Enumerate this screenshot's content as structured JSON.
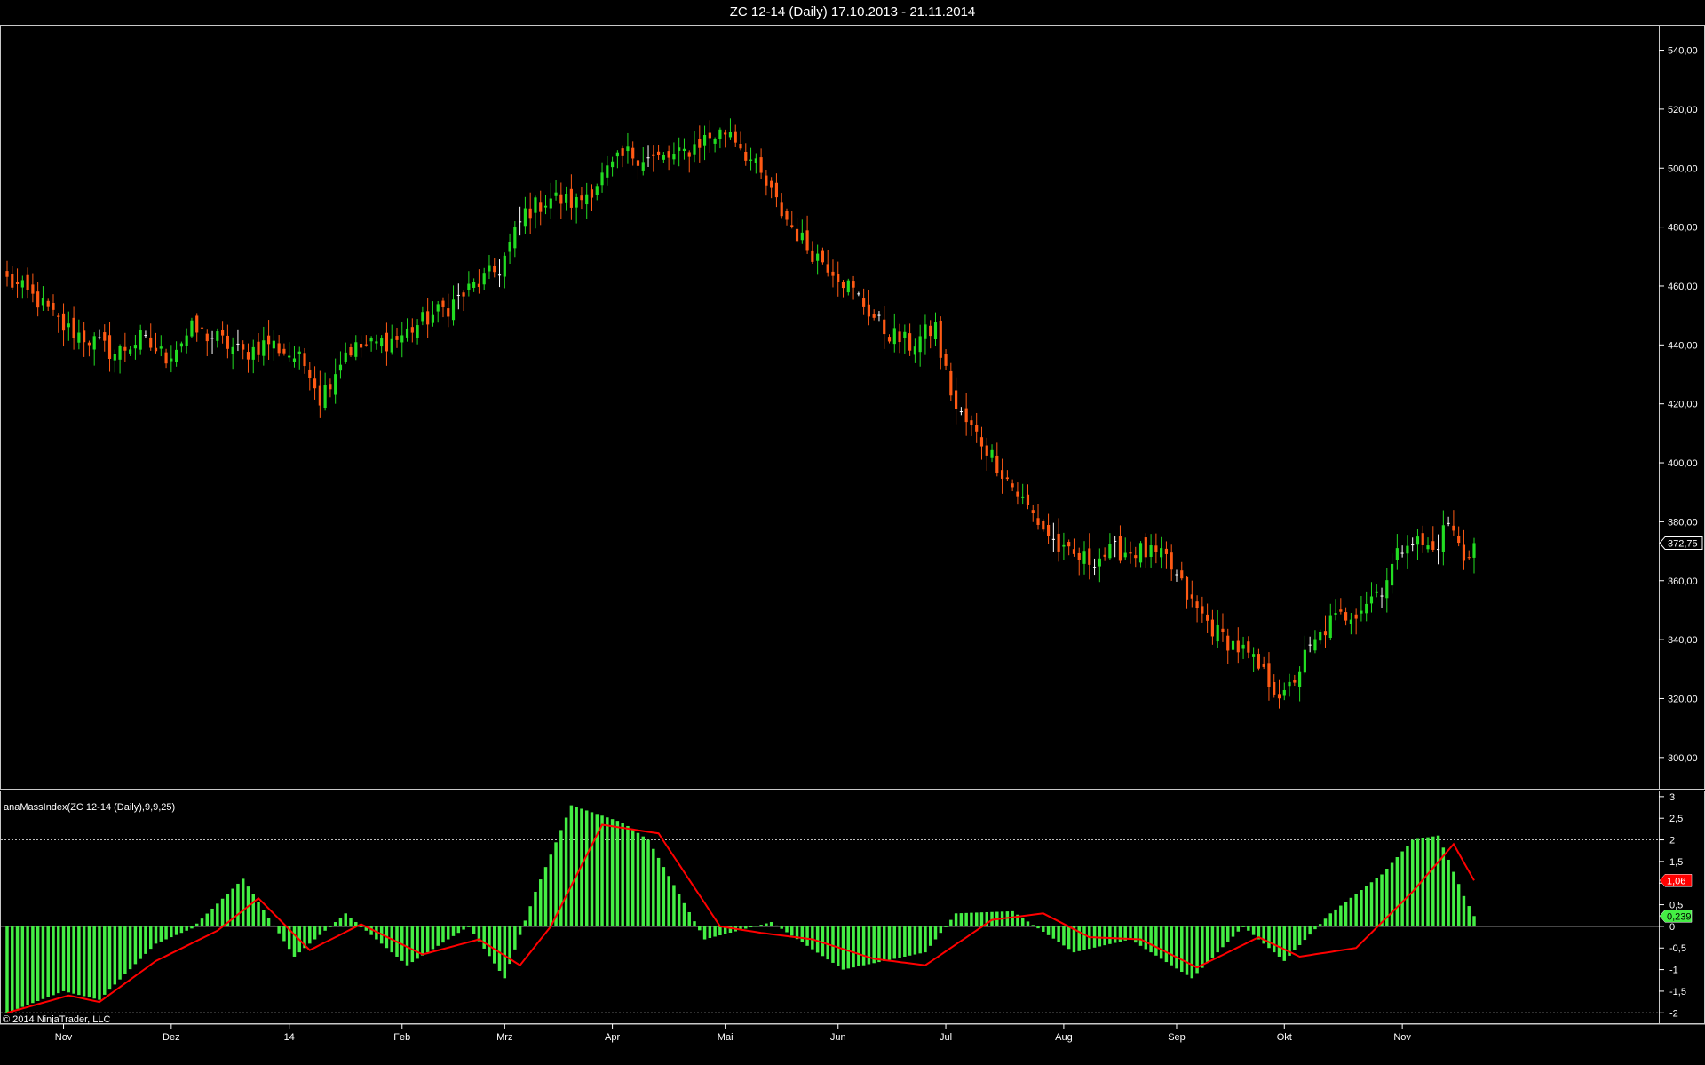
{
  "window": {
    "title": "ZC 12-14 (Daily)  17.10.2013 - 21.11.2014"
  },
  "colors": {
    "up": "#22dd22",
    "down": "#ff5a14",
    "doji": "#ffffff",
    "histogram": "#44ee44",
    "signal": "#ff0000",
    "axis": "#ffffff"
  },
  "chart_data": [
    {
      "type": "candlestick",
      "title": "ZC 12-14 (Daily)  17.10.2013 - 21.11.2014",
      "ylim": [
        290,
        548
      ],
      "y_ticks": [
        "300,00",
        "320,00",
        "340,00",
        "360,00",
        "380,00",
        "400,00",
        "420,00",
        "440,00",
        "460,00",
        "480,00",
        "500,00",
        "520,00",
        "540,00"
      ],
      "last_price": "372,75",
      "close_anchors": [
        [
          "2013-10-17",
          462
        ],
        [
          "2013-10-25",
          455
        ],
        [
          "2013-11-01",
          446
        ],
        [
          "2013-11-08",
          442
        ],
        [
          "2013-11-15",
          437
        ],
        [
          "2013-11-22",
          442
        ],
        [
          "2013-11-29",
          436
        ],
        [
          "2013-12-06",
          445
        ],
        [
          "2013-12-13",
          442
        ],
        [
          "2013-12-20",
          437
        ],
        [
          "2013-12-27",
          441
        ],
        [
          "2014-01-03",
          436
        ],
        [
          "2014-01-08",
          432
        ],
        [
          "2014-01-10",
          422
        ],
        [
          "2014-01-17",
          438
        ],
        [
          "2014-01-24",
          440
        ],
        [
          "2014-01-31",
          442
        ],
        [
          "2014-02-07",
          448
        ],
        [
          "2014-02-14",
          453
        ],
        [
          "2014-02-21",
          460
        ],
        [
          "2014-02-28",
          466
        ],
        [
          "2014-03-07",
          485
        ],
        [
          "2014-03-14",
          490
        ],
        [
          "2014-03-21",
          488
        ],
        [
          "2014-03-28",
          497
        ],
        [
          "2014-04-04",
          505
        ],
        [
          "2014-04-11",
          503
        ],
        [
          "2014-04-18",
          504
        ],
        [
          "2014-04-25",
          510
        ],
        [
          "2014-05-02",
          513
        ],
        [
          "2014-05-09",
          500
        ],
        [
          "2014-05-16",
          485
        ],
        [
          "2014-05-23",
          473
        ],
        [
          "2014-05-30",
          466
        ],
        [
          "2014-06-06",
          456
        ],
        [
          "2014-06-13",
          445
        ],
        [
          "2014-06-20",
          440
        ],
        [
          "2014-06-27",
          446
        ],
        [
          "2014-06-30",
          437
        ],
        [
          "2014-07-03",
          418
        ],
        [
          "2014-07-11",
          405
        ],
        [
          "2014-07-18",
          392
        ],
        [
          "2014-07-25",
          380
        ],
        [
          "2014-08-01",
          369
        ],
        [
          "2014-08-08",
          367
        ],
        [
          "2014-08-15",
          370
        ],
        [
          "2014-08-22",
          370
        ],
        [
          "2014-08-29",
          367
        ],
        [
          "2014-09-05",
          352
        ],
        [
          "2014-09-12",
          342
        ],
        [
          "2014-09-19",
          336
        ],
        [
          "2014-09-26",
          326
        ],
        [
          "2014-10-01",
          320
        ],
        [
          "2014-10-07",
          334
        ],
        [
          "2014-10-14",
          346
        ],
        [
          "2014-10-21",
          350
        ],
        [
          "2014-10-28",
          358
        ],
        [
          "2014-11-04",
          375
        ],
        [
          "2014-11-11",
          370
        ],
        [
          "2014-11-14",
          380
        ],
        [
          "2014-11-19",
          368
        ],
        [
          "2014-11-21",
          372.75
        ]
      ]
    },
    {
      "type": "bar+line",
      "title": "anaMassIndex(ZC 12-14 (Daily),9,9,25)",
      "ylim": [
        -2.2,
        3.1
      ],
      "y_ticks": [
        "-2",
        "-1,5",
        "-1",
        "-0,5",
        "0",
        "0,5",
        "1",
        "1,5",
        "2",
        "2,5",
        "3"
      ],
      "reference_lines": [
        2,
        0,
        -2
      ],
      "last_signal": "1,06",
      "last_histogram": "0,239",
      "histogram_anchors": [
        [
          "2013-10-17",
          -2.0
        ],
        [
          "2013-11-01",
          -1.5
        ],
        [
          "2013-11-12",
          -1.7
        ],
        [
          "2013-11-27",
          -0.4
        ],
        [
          "2013-12-06",
          -0.05
        ],
        [
          "2013-12-20",
          1.1
        ],
        [
          "2014-01-03",
          -0.7
        ],
        [
          "2014-01-17",
          0.3
        ],
        [
          "2014-02-04",
          -0.9
        ],
        [
          "2014-02-20",
          0.0
        ],
        [
          "2014-03-03",
          -1.2
        ],
        [
          "2014-03-11",
          0.8
        ],
        [
          "2014-03-20",
          2.8
        ],
        [
          "2014-04-03",
          2.4
        ],
        [
          "2014-04-10",
          2.0
        ],
        [
          "2014-04-25",
          -0.3
        ],
        [
          "2014-05-14",
          0.1
        ],
        [
          "2014-06-03",
          -1.0
        ],
        [
          "2014-06-25",
          -0.6
        ],
        [
          "2014-07-03",
          0.3
        ],
        [
          "2014-07-18",
          0.35
        ],
        [
          "2014-08-05",
          -0.6
        ],
        [
          "2014-08-20",
          -0.3
        ],
        [
          "2014-09-05",
          -1.2
        ],
        [
          "2014-09-19",
          0.0
        ],
        [
          "2014-10-01",
          -0.8
        ],
        [
          "2014-10-14",
          0.3
        ],
        [
          "2014-10-28",
          1.2
        ],
        [
          "2014-11-05",
          2.0
        ],
        [
          "2014-11-12",
          2.1
        ],
        [
          "2014-11-19",
          0.7
        ],
        [
          "2014-11-21",
          0.239
        ]
      ],
      "signal_anchors": [
        [
          "2013-10-17",
          -2.0
        ],
        [
          "2013-11-04",
          -1.6
        ],
        [
          "2013-11-12",
          -1.75
        ],
        [
          "2013-11-27",
          -0.8
        ],
        [
          "2013-12-13",
          -0.1
        ],
        [
          "2013-12-25",
          0.65
        ],
        [
          "2014-01-08",
          -0.55
        ],
        [
          "2014-01-22",
          0.05
        ],
        [
          "2014-02-07",
          -0.65
        ],
        [
          "2014-02-24",
          -0.3
        ],
        [
          "2014-03-06",
          -0.9
        ],
        [
          "2014-03-14",
          0.0
        ],
        [
          "2014-03-28",
          2.35
        ],
        [
          "2014-04-14",
          2.15
        ],
        [
          "2014-04-30",
          0.0
        ],
        [
          "2014-05-12",
          -0.15
        ],
        [
          "2014-05-26",
          -0.3
        ],
        [
          "2014-06-11",
          -0.75
        ],
        [
          "2014-06-25",
          -0.9
        ],
        [
          "2014-07-14",
          0.15
        ],
        [
          "2014-07-28",
          0.3
        ],
        [
          "2014-08-08",
          -0.25
        ],
        [
          "2014-08-22",
          -0.3
        ],
        [
          "2014-09-08",
          -0.95
        ],
        [
          "2014-09-24",
          -0.25
        ],
        [
          "2014-10-06",
          -0.7
        ],
        [
          "2014-10-21",
          -0.5
        ],
        [
          "2014-11-05",
          0.8
        ],
        [
          "2014-11-17",
          1.9
        ],
        [
          "2014-11-21",
          1.06
        ]
      ]
    }
  ],
  "x_axis": {
    "labels": [
      "Nov",
      "Dez",
      "14",
      "Feb",
      "Mrz",
      "Apr",
      "Mai",
      "Jun",
      "Jul",
      "Aug",
      "Sep",
      "Okt",
      "Nov"
    ],
    "label_dates": [
      "2013-11-01",
      "2013-12-02",
      "2014-01-02",
      "2014-02-03",
      "2014-03-03",
      "2014-04-01",
      "2014-05-01",
      "2014-06-02",
      "2014-07-01",
      "2014-08-01",
      "2014-09-02",
      "2014-10-01",
      "2014-11-03"
    ]
  },
  "indicator_label": "anaMassIndex(ZC 12-14 (Daily),9,9,25)",
  "copyright": "© 2014 NinjaTrader, LLC"
}
